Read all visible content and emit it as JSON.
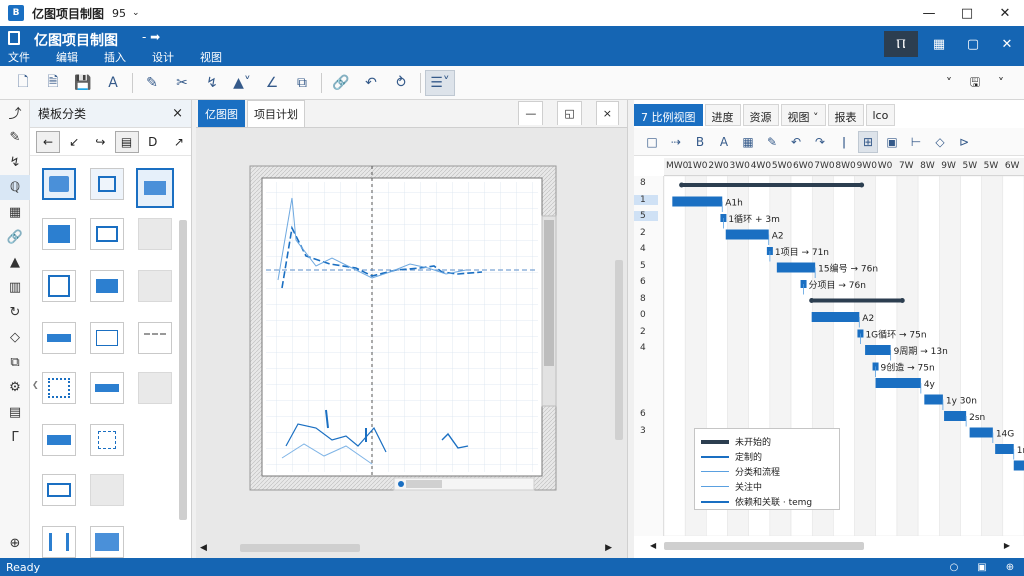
{
  "titlebar": {
    "app_icon": "app-logo-icon",
    "title": "亿图项目制图",
    "version": "95",
    "chevron": "chevron-down-icon"
  },
  "window_controls": [
    "minimize-icon",
    "maximize-icon",
    "close-icon"
  ],
  "ribbon": {
    "title": "亿图项目制图",
    "mini_actions": "- ➡",
    "tabs": [
      "文件",
      "编辑",
      "插入",
      "设计",
      "视图"
    ],
    "right_controls": [
      "user-icon",
      "grid-icon",
      "window-icon",
      "close-icon"
    ]
  },
  "toolbar": {
    "icons": [
      "new-icon",
      "open-icon",
      "save-icon",
      "text-icon",
      "pen-icon",
      "cut-icon",
      "paste-icon",
      "shape-icon",
      "line-icon",
      "copy-icon",
      "link-icon",
      "undo-icon",
      "redo-icon",
      "list-icon"
    ],
    "right_icons": [
      "chevron-down-icon",
      "export-icon",
      "chevron-down-icon"
    ]
  },
  "left_strip": [
    "pointer-icon",
    "brush-icon",
    "connector-icon",
    "template-icon",
    "table-icon",
    "link-icon",
    "tree-icon",
    "gantt-icon",
    "refresh-icon",
    "shape-icon",
    "layer-icon",
    "settings-icon",
    "comment-icon",
    "bracket-icon",
    "add-icon"
  ],
  "template_panel": {
    "header": "模板分类",
    "close": "×",
    "subtools": [
      "←",
      "↙",
      "↪",
      "▤",
      "D",
      "↗"
    ]
  },
  "canvas": {
    "tabs": [
      {
        "label": "亿图图",
        "active": true
      },
      {
        "label": "项目计划",
        "active": false
      }
    ],
    "controls": [
      "—",
      "◱",
      "×"
    ]
  },
  "gantt": {
    "tabs": [
      {
        "label": "7 比例视图",
        "active": true
      },
      {
        "label": "进度",
        "active": false
      },
      {
        "label": "资源",
        "active": false
      },
      {
        "label": "视图 ˅",
        "active": false
      },
      {
        "label": "报表",
        "active": false
      },
      {
        "label": "lco",
        "active": false
      }
    ],
    "toolbar": [
      "□",
      "⇢",
      "B",
      "A",
      "▦",
      "✎",
      "↶",
      "↷",
      "ǀ",
      "⊞",
      "▣",
      "⊢",
      "◇",
      "⊳"
    ],
    "date_headers": [
      "MW0",
      "1W0",
      "2W0",
      "3W0",
      "4W0",
      "5W0",
      "6W0",
      "7W0",
      "8W0",
      "9W0",
      "W0",
      "7W",
      "8W",
      "9W",
      "5W",
      "5W",
      "6W"
    ],
    "row_numbers": [
      "8",
      "1",
      "5",
      "2",
      "4",
      "5",
      "6",
      "8",
      "0",
      "2",
      "4",
      "",
      "",
      "",
      "6",
      "3",
      "",
      ""
    ],
    "tasks": [
      {
        "label": "",
        "start": 1,
        "end": 16.5,
        "kind": "summary"
      },
      {
        "label": "A1h",
        "start": 0.2,
        "end": 4.5,
        "kind": "task"
      },
      {
        "label": "1循环 + 3m",
        "start": 4.6,
        "end": 4.6,
        "kind": "milestone"
      },
      {
        "label": "A2",
        "start": 4.8,
        "end": 8.5,
        "kind": "task"
      },
      {
        "label": "1项目 → 71n",
        "start": 8.6,
        "end": 8.6,
        "kind": "milestone"
      },
      {
        "label": "15编号 → 76n",
        "start": 9.2,
        "end": 12.5,
        "kind": "task"
      },
      {
        "label": "分项目 → 76n",
        "start": 11.5,
        "end": 11.5,
        "kind": "milestone"
      },
      {
        "label": "",
        "start": 12.2,
        "end": 20,
        "kind": "summary"
      },
      {
        "label": "A2",
        "start": 12.2,
        "end": 16.3,
        "kind": "task"
      },
      {
        "label": "1G循环 → 75n",
        "start": 16.4,
        "end": 16.4,
        "kind": "milestone"
      },
      {
        "label": "9周期 → 13n",
        "start": 16.8,
        "end": 19,
        "kind": "task"
      },
      {
        "label": "9创造 → 75n",
        "start": 17.7,
        "end": 17.7,
        "kind": "milestone"
      },
      {
        "label": "4y",
        "start": 17.7,
        "end": 21.6,
        "kind": "task"
      },
      {
        "label": "1y 30n",
        "start": 21.9,
        "end": 23.5,
        "kind": "task"
      },
      {
        "label": "2sn",
        "start": 23.6,
        "end": 25.5,
        "kind": "task"
      },
      {
        "label": "14G",
        "start": 25.8,
        "end": 27.8,
        "kind": "task"
      },
      {
        "label": "1n",
        "start": 28,
        "end": 29.6,
        "kind": "task"
      },
      {
        "label": "",
        "start": 29.6,
        "end": 30.6,
        "kind": "task"
      }
    ],
    "legend": [
      {
        "label": "未开始的",
        "color": "#2c3e50",
        "weight": 4
      },
      {
        "label": "定制的",
        "color": "#1a6fc2",
        "weight": 2
      },
      {
        "label": "分类和流程",
        "color": "#5aa0e0",
        "weight": 1.5
      },
      {
        "label": "关注中",
        "color": "#5aa0e0",
        "weight": 1.5
      },
      {
        "label": "依赖和关联 · temg",
        "color": "#1a6fc2",
        "weight": 2
      }
    ]
  },
  "statusbar": {
    "text": "Ready",
    "right_icons": [
      "zoom-out-icon",
      "fit-icon",
      "zoom-in-icon"
    ]
  }
}
